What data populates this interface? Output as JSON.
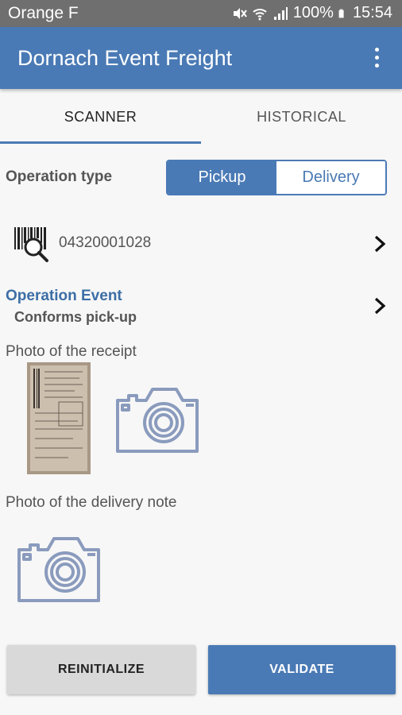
{
  "status_bar": {
    "carrier": "Orange F",
    "battery": "100%",
    "time": "15:54"
  },
  "app_bar": {
    "title": "Dornach Event Freight"
  },
  "tabs": [
    {
      "label": "SCANNER",
      "selected": true
    },
    {
      "label": "HISTORICAL",
      "selected": false
    }
  ],
  "operation": {
    "label": "Operation type",
    "options": [
      "Pickup",
      "Delivery"
    ],
    "selected": "Pickup"
  },
  "scan": {
    "code": "04320001028"
  },
  "event": {
    "label": "Operation Event",
    "value": "Conforms pick-up"
  },
  "receipt": {
    "label": "Photo of the receipt"
  },
  "delivery_note": {
    "label": "Photo of the delivery note"
  },
  "actions": {
    "reinitialize": "REINITIALIZE",
    "validate": "VALIDATE"
  },
  "colors": {
    "primary": "#4a7ab5",
    "status_bar": "#6f6f6f",
    "camera_icon": "#8a9bbd"
  }
}
